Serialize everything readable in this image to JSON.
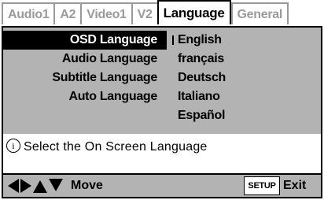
{
  "tabs": [
    {
      "label": "Audio1",
      "active": false
    },
    {
      "label": "A2",
      "active": false
    },
    {
      "label": "Video1",
      "active": false
    },
    {
      "label": "V2",
      "active": false
    },
    {
      "label": "Language",
      "active": true
    },
    {
      "label": "General",
      "active": false
    }
  ],
  "menu": {
    "items": [
      "OSD Language",
      "Audio Language",
      "Subtitle Language",
      "Auto Language"
    ],
    "selected_index": 0
  },
  "options": {
    "items": [
      "English",
      "français",
      "Deutsch",
      "Italiano",
      "Español"
    ],
    "selected_index": 0
  },
  "info": {
    "icon": "info-icon",
    "text": "Select the On Screen Language"
  },
  "footer": {
    "move_label": "Move",
    "setup_label": "SETUP",
    "exit_label": "Exit"
  },
  "colors": {
    "panel_gray": "#b3b3b3",
    "tab_inactive_text": "#9a9a9a",
    "selected_bg": "#000000"
  }
}
